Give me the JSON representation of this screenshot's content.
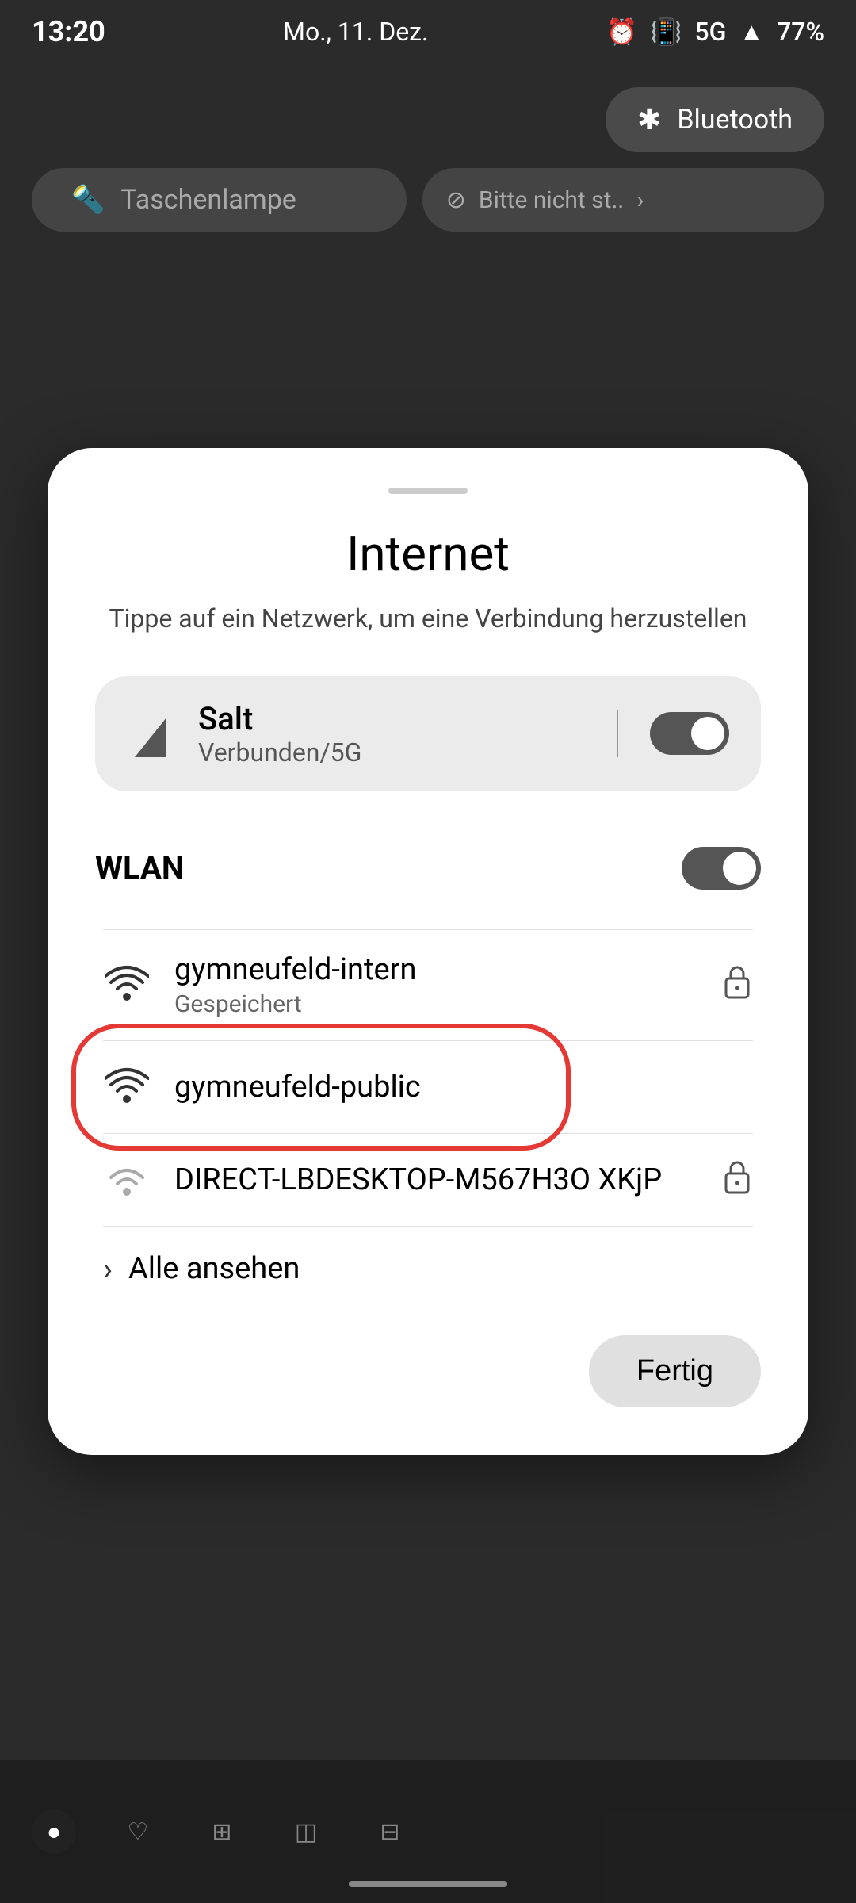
{
  "statusBar": {
    "time": "13:20",
    "date": "Mo., 11. Dez.",
    "alarm": "⏰",
    "vibrate": "📳",
    "network": "5G",
    "signal": "▲",
    "battery": "77%"
  },
  "quickTiles": {
    "bluetooth": {
      "icon": "✱",
      "label": "Bluetooth"
    },
    "flashlight": {
      "icon": "🔦",
      "label": "Taschenlampe"
    },
    "dnd": {
      "icon": "⊘",
      "label": "Bitte nicht st..",
      "arrow": "›"
    }
  },
  "modal": {
    "title": "Internet",
    "subtitle": "Tippe auf ein Netzwerk, um eine Verbindung herzustellen",
    "mobileNetwork": {
      "name": "Salt",
      "status": "Verbunden/5G",
      "toggleOn": true
    },
    "wlanLabel": "WLAN",
    "wlanToggleOn": true,
    "networks": [
      {
        "name": "gymneufeld-intern",
        "sub": "Gespeichert",
        "secured": true,
        "highlighted": false,
        "signalFull": true
      },
      {
        "name": "gymneufeld-public",
        "sub": "",
        "secured": false,
        "highlighted": true,
        "signalFull": true
      },
      {
        "name": "DIRECT-LBDESKTOP-M567H3O XKjP",
        "sub": "",
        "secured": true,
        "highlighted": false,
        "signalFull": false
      }
    ],
    "seeAll": "Alle ansehen",
    "fertig": "Fertig"
  },
  "bottomNav": {
    "icons": [
      "●",
      "♡?",
      "⊞",
      "◫",
      "⊟"
    ]
  }
}
